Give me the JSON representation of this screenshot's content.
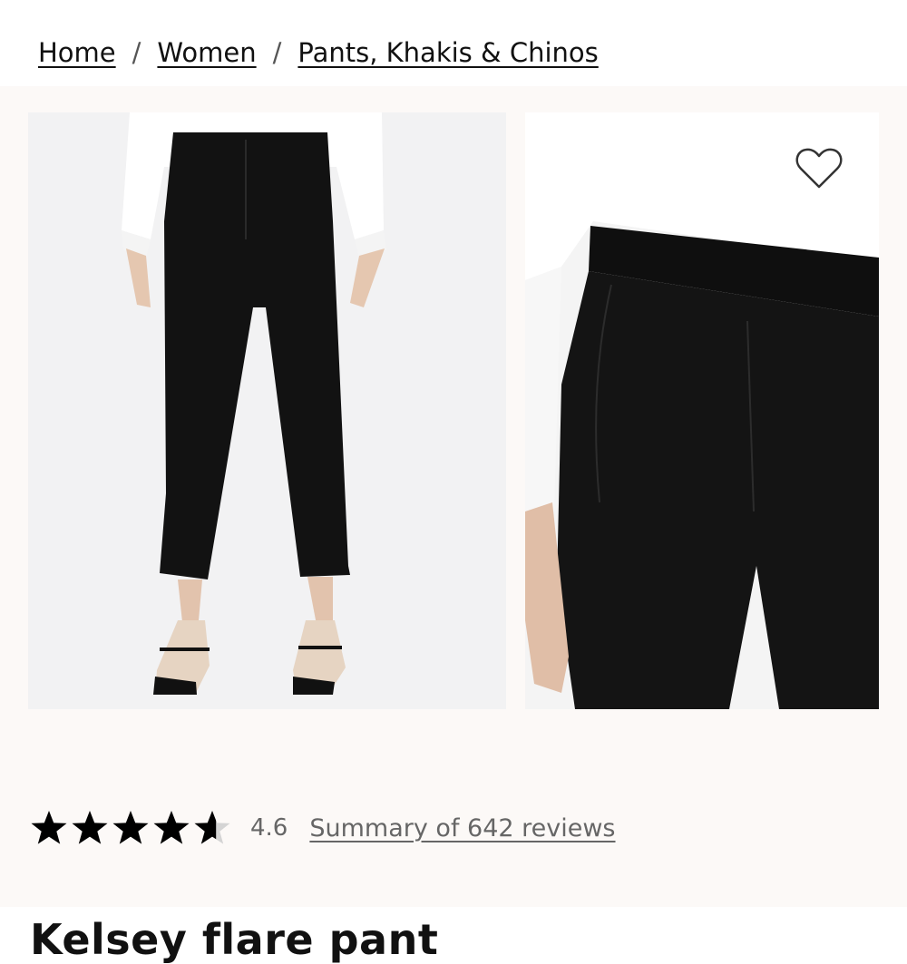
{
  "breadcrumb": {
    "items": [
      {
        "label": "Home"
      },
      {
        "label": "Women"
      },
      {
        "label": "Pants, Khakis & Chinos"
      }
    ],
    "separator": "/"
  },
  "gallery": {
    "images": [
      {
        "icon": "product-photo-full-length"
      },
      {
        "icon": "product-photo-waistband-closeup"
      }
    ],
    "wishlist_icon": "heart-icon"
  },
  "rating": {
    "stars_value": 4.6,
    "stars_max": 5,
    "value_text": "4.6",
    "reviews_link": "Summary of 642 reviews"
  },
  "product": {
    "title": "Kelsey flare pant"
  },
  "colors": {
    "page_bg": "#fcf9f7",
    "text": "#111111",
    "muted": "#666666",
    "garment": "#111111"
  }
}
